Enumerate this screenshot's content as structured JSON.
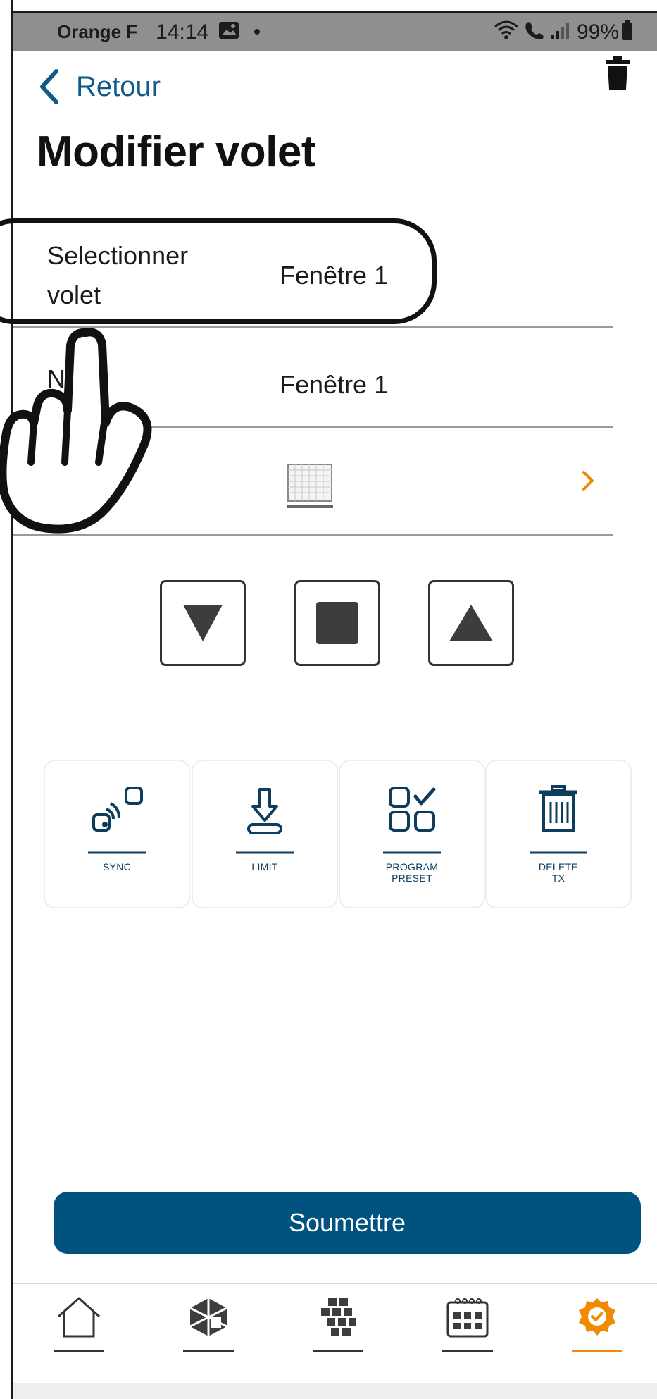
{
  "status_bar": {
    "carrier": "Orange F",
    "time": "14:14",
    "battery": "99%",
    "icons": [
      "gallery-icon",
      "dot-icon",
      "wifi-icon",
      "call-icon",
      "signal-icon",
      "battery-icon"
    ]
  },
  "header": {
    "back_label": "Retour",
    "title": "Modifier volet",
    "delete_icon": "trash-icon"
  },
  "form": {
    "select_label": "Selectionner volet",
    "select_value": "Fenêtre 1",
    "name_label": "N",
    "name_value": "Fenêtre 1",
    "type_icon": "window-shutter-icon",
    "type_arrow_icon": "chevron-right-icon"
  },
  "controls": {
    "down_icon": "triangle-down-icon",
    "stop_icon": "square-stop-icon",
    "up_icon": "triangle-up-icon"
  },
  "tiles": [
    {
      "label": "SYNC",
      "icon": "sync-icon"
    },
    {
      "label": "LIMIT",
      "icon": "limit-icon"
    },
    {
      "label": "PROGRAM\nPRESET",
      "icon": "program-preset-icon"
    },
    {
      "label": "DELETE\nTX",
      "icon": "delete-tx-icon"
    }
  ],
  "submit_label": "Soumettre",
  "bottom_nav": [
    {
      "icon": "home-icon",
      "active": false
    },
    {
      "icon": "rooms-icon",
      "active": false
    },
    {
      "icon": "scenes-icon",
      "active": false
    },
    {
      "icon": "calendar-icon",
      "active": false
    },
    {
      "icon": "settings-icon",
      "active": true
    }
  ],
  "colors": {
    "accent_blue": "#00527f",
    "link_blue": "#0e5a8a",
    "active_orange": "#f08a00",
    "status_bar_gray": "#8f8f8f"
  }
}
